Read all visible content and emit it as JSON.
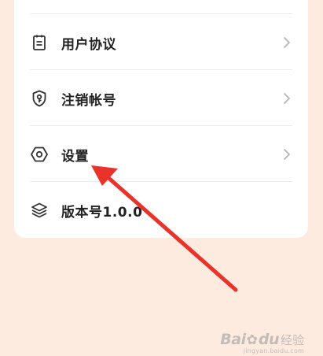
{
  "menu": {
    "items": [
      {
        "label": "用户协议",
        "icon": "document-icon",
        "has_chevron": true
      },
      {
        "label": "注销帐号",
        "icon": "shield-key-icon",
        "has_chevron": true
      },
      {
        "label": "设置",
        "icon": "hexagon-settings-icon",
        "has_chevron": true
      },
      {
        "label": "版本号1.0.0",
        "icon": "layers-icon",
        "has_chevron": false
      }
    ]
  },
  "colors": {
    "background": "#fdebe0",
    "card": "#ffffff",
    "text": "#222222",
    "chevron": "#b5b5b5",
    "annotation_arrow": "#e8322a"
  },
  "watermark": {
    "brand": "Bai",
    "brand_suffix": "du",
    "cn": "经验",
    "sub": "jingyan.baidu.com"
  }
}
